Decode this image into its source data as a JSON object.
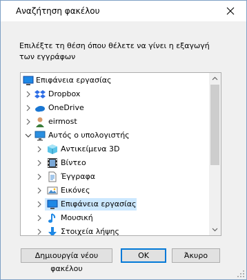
{
  "window": {
    "title": "Αναζήτηση φακέλου"
  },
  "instruction": "Επιλέξτε τη θέση όπου θέλετε να γίνει η εξαγωγή των εγγράφων",
  "tree": {
    "items": [
      {
        "label": "Επιφάνεια εργασίας",
        "icon": "desktop-icon"
      },
      {
        "label": "Dropbox",
        "icon": "dropbox-icon"
      },
      {
        "label": "OneDrive",
        "icon": "onedrive-icon"
      },
      {
        "label": "eirmost",
        "icon": "user-icon"
      },
      {
        "label": "Αυτός ο υπολογιστής",
        "icon": "computer-icon"
      },
      {
        "label": "Αντικείμενα 3D",
        "icon": "3d-objects-icon"
      },
      {
        "label": "Βίντεο",
        "icon": "video-icon"
      },
      {
        "label": "Έγγραφα",
        "icon": "documents-icon"
      },
      {
        "label": "Εικόνες",
        "icon": "pictures-icon"
      },
      {
        "label": "Επιφάνεια εργασίας",
        "icon": "desktop-icon",
        "selected": true
      },
      {
        "label": "Μουσική",
        "icon": "music-icon"
      },
      {
        "label": "Στοιχεία λήψης",
        "icon": "downloads-icon"
      }
    ]
  },
  "buttons": {
    "new_folder": "Δημιουργία νέου φακέλου",
    "ok": "OK",
    "cancel": "Άκυρο"
  },
  "colors": {
    "selection": "#cce8ff",
    "accent": "#0078d7"
  }
}
